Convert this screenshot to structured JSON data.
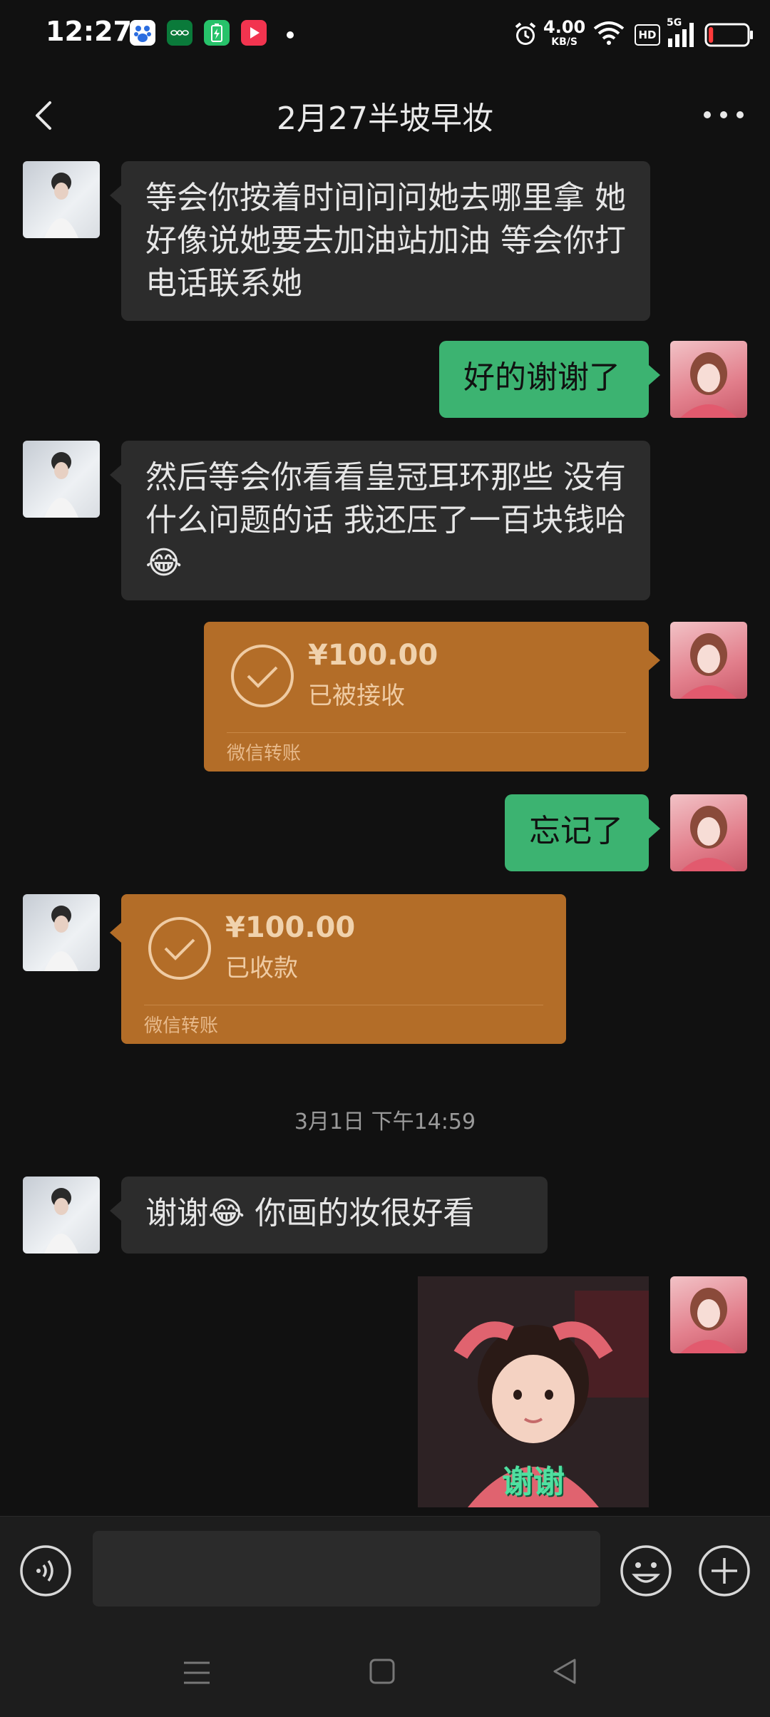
{
  "status_bar": {
    "time": "12:27",
    "network_speed": "4.00",
    "network_speed_unit": "KB/S",
    "hd_label": "HD",
    "signal_label": "5G",
    "app_icons": [
      "baidu-icon",
      "oppo-icon",
      "battery-app-icon",
      "video-app-icon"
    ],
    "battery_level": 0.12
  },
  "header": {
    "title": "2月27半坡早妆"
  },
  "messages": [
    {
      "text": "等会你按着时间问问她去哪里拿 她好像说她要去加油站加油 等会你打电话联系她"
    },
    {
      "text": "好的谢谢了"
    },
    {
      "text": "然后等会你看看皇冠耳环那些 没有什么问题的话 我还压了一百块钱哈😂"
    },
    {
      "amount": "¥100.00",
      "status": "已被接收",
      "footer": "微信转账"
    },
    {
      "text": "忘记了"
    },
    {
      "amount": "¥100.00",
      "status": "已收款",
      "footer": "微信转账"
    },
    {
      "text": "谢谢😂 你画的妆很好看"
    },
    {
      "caption": "谢谢"
    }
  ],
  "timestamp": "3月1日 下午14:59",
  "input": {
    "placeholder": ""
  },
  "colors": {
    "bubble_sent": "#3cb371",
    "bubble_received": "#2c2c2c",
    "transfer": "#b36d28",
    "background": "#111111"
  }
}
